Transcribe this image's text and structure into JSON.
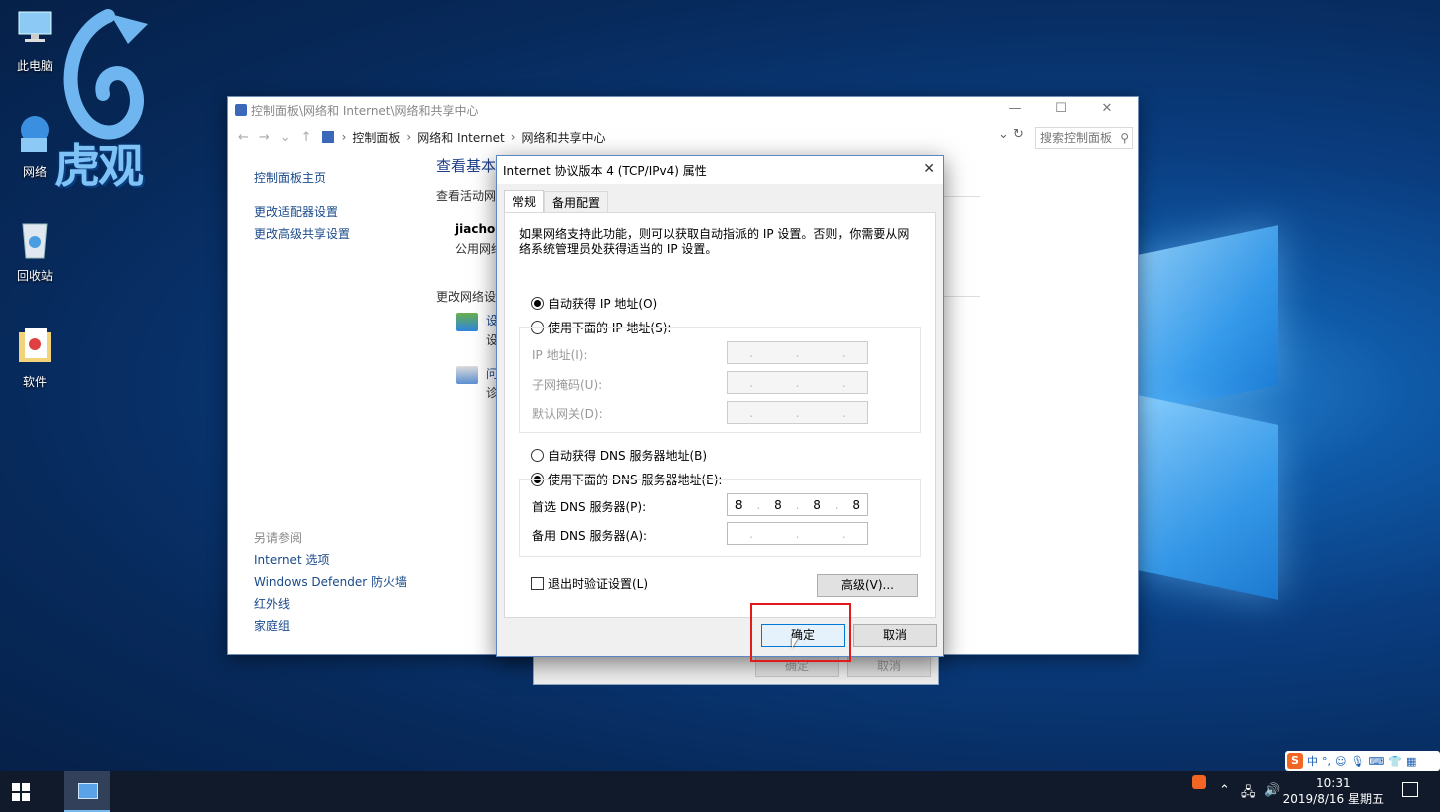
{
  "desktop": {
    "icons": [
      {
        "label": "此电脑",
        "icon": "computer-icon"
      },
      {
        "label": "网络",
        "icon": "network-icon"
      },
      {
        "label": "回收站",
        "icon": "recycle-bin-icon"
      },
      {
        "label": "软件",
        "icon": "folder-icon"
      }
    ],
    "watermark": "虎观"
  },
  "explorer": {
    "title": "控制面板\\网络和 Internet\\网络和共享中心",
    "window_buttons": [
      "—",
      "☐",
      "✕"
    ],
    "breadcrumb": [
      "控制面板",
      "网络和 Internet",
      "网络和共享中心"
    ],
    "search_placeholder": "搜索控制面板",
    "left_nav": {
      "home": "控制面板主页",
      "items": [
        "更改适配器设置",
        "更改高级共享设置"
      ]
    },
    "see_also": {
      "heading": "另请参阅",
      "items": [
        "Internet 选项",
        "Windows Defender 防火墙",
        "红外线",
        "家庭组"
      ]
    },
    "main": {
      "title": "查看基本",
      "active_networks": "查看活动网络",
      "network_name": "jiachon",
      "network_type": "公用网络",
      "change_settings": "更改网络设置",
      "item1_a": "设",
      "item1_b": "设",
      "item2_a": "问",
      "item2_b": "诊"
    }
  },
  "back_dialog": {
    "ok": "确定",
    "cancel": "取消"
  },
  "ipv4_dialog": {
    "title": "Internet 协议版本 4 (TCP/IPv4) 属性",
    "close": "✕",
    "tabs": [
      "常规",
      "备用配置"
    ],
    "description": "如果网络支持此功能，则可以获取自动指派的 IP 设置。否则，你需要从网络系统管理员处获得适当的 IP 设置。",
    "ip_auto": "自动获得 IP 地址(O)",
    "ip_manual": "使用下面的 IP 地址(S):",
    "ip_auto_selected": true,
    "ip_label": "IP 地址(I):",
    "mask_label": "子网掩码(U):",
    "gateway_label": "默认网关(D):",
    "dns_auto": "自动获得 DNS 服务器地址(B)",
    "dns_manual": "使用下面的 DNS 服务器地址(E):",
    "dns_manual_selected": true,
    "preferred_dns_label": "首选 DNS 服务器(P):",
    "preferred_dns": [
      "8",
      "8",
      "8",
      "8"
    ],
    "alternate_dns_label": "备用 DNS 服务器(A):",
    "validate_label": "退出时验证设置(L)",
    "validate_checked": false,
    "advanced": "高级(V)...",
    "ok": "确定",
    "cancel": "取消"
  },
  "taskbar": {
    "time": "10:31",
    "date": "2019/8/16 星期五",
    "ime_label": "中",
    "tray_icons": [
      "sogou-icon",
      "chevron-up-icon",
      "network-icon",
      "volume-icon",
      "notification-icon"
    ]
  },
  "colors": {
    "accent": "#0078d7",
    "highlight_box": "#e11b1b",
    "link": "#1a4a8a"
  }
}
